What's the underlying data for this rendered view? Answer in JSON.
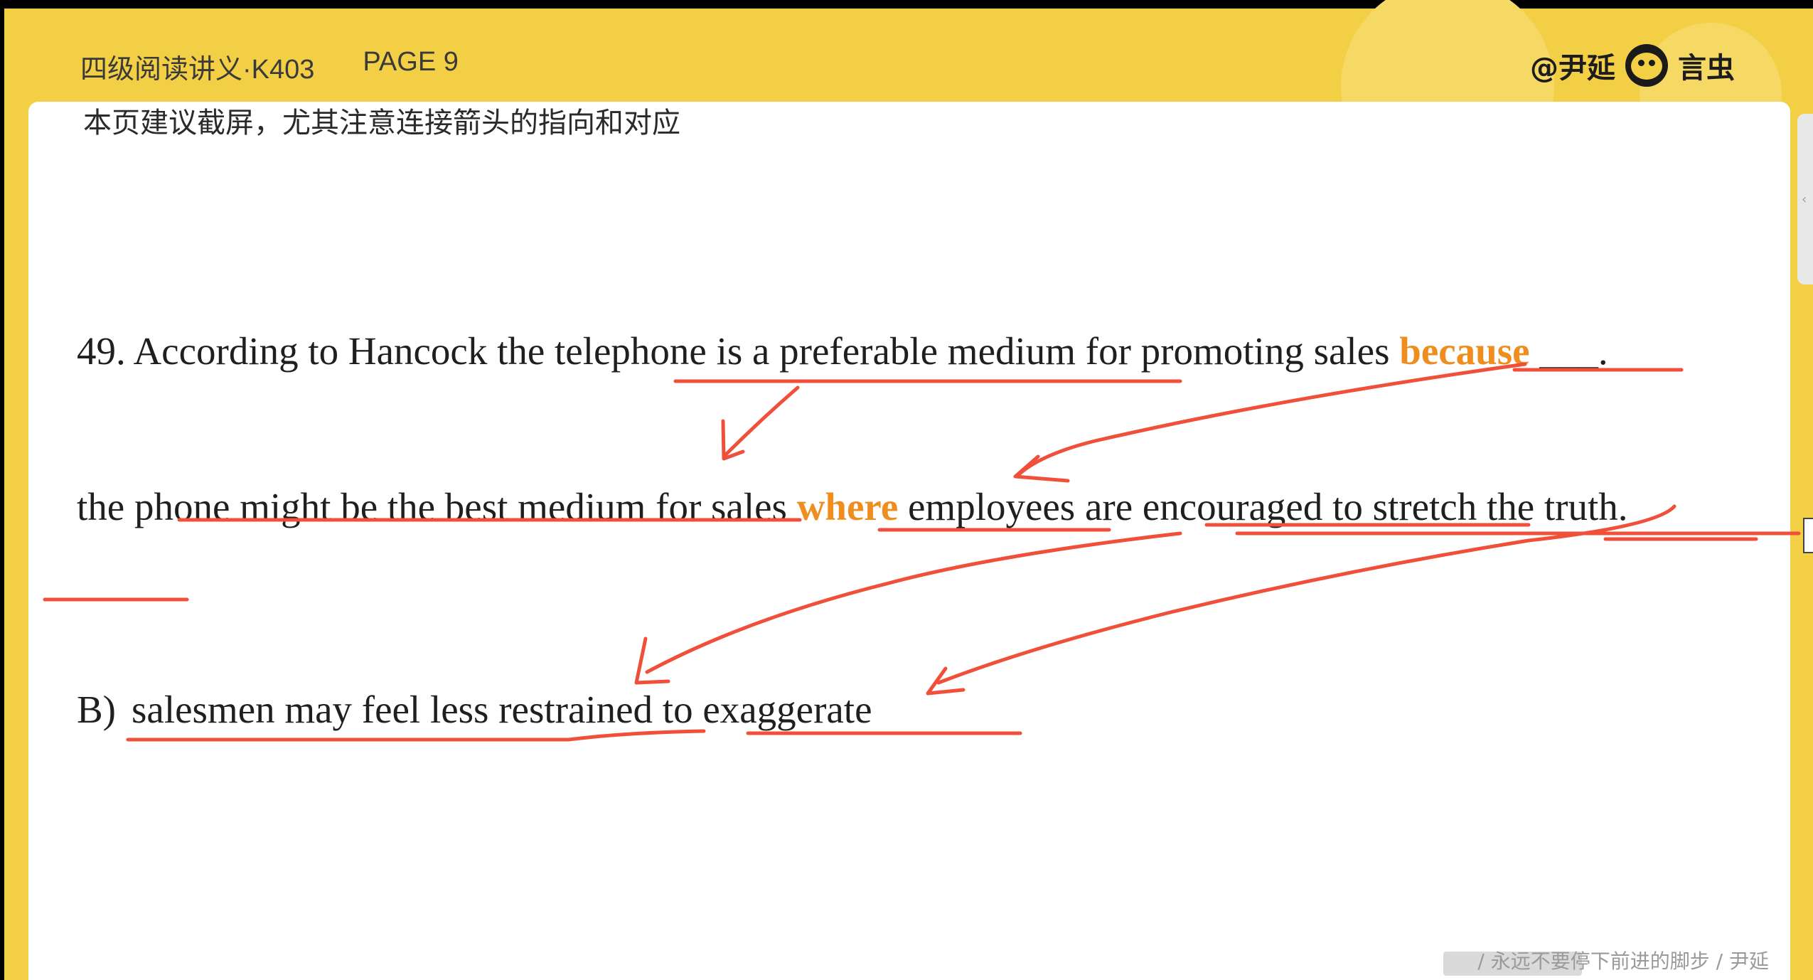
{
  "header": {
    "course": "四级阅读讲义·K403",
    "page": "PAGE 9",
    "brand_handle": "@尹延",
    "brand_name": "言虫",
    "brand_logo_icon": "bug-face-icon"
  },
  "tip": "本页建议截屏，尤其注意连接箭头的指向和对应",
  "question": {
    "before_keyword": "49. According to Hancock the telephone is a preferable medium for promoting sales ",
    "keyword": "because",
    "after_keyword": " ___."
  },
  "passage": {
    "before_keyword": "the phone might be the best medium for sales ",
    "keyword": "where",
    "after_keyword": " employees are encouraged to stretch the truth."
  },
  "option": {
    "label": "B)",
    "text": "salesmen may feel less restrained to exaggerate"
  },
  "footer": {
    "watermark": "/ 永远不要停下前进的脚步 /  尹延"
  },
  "colors": {
    "frame_yellow": "#f3cf45",
    "keyword_orange": "#ef8d1e",
    "annotation_red": "#f0503a"
  }
}
